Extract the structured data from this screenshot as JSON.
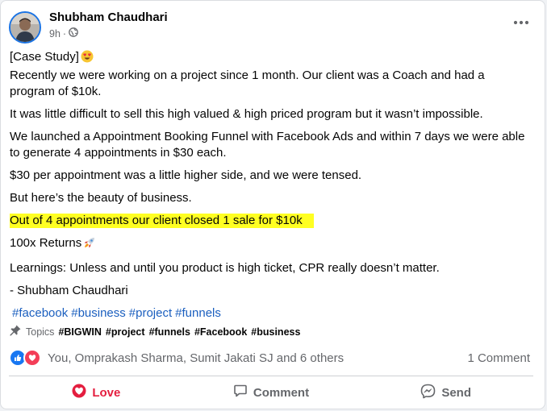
{
  "post": {
    "author": "Shubham Chaudhari",
    "time": "9h",
    "separator": "·",
    "visibility_icon": "globe-icon",
    "more_icon": "more-options-icon"
  },
  "body": {
    "line1": "[Case Study]",
    "line1_emoji": "heart-eyes-emoji",
    "p1": "Recently we were working on a project since 1 month. Our client was a Coach and had a program of $10k.",
    "p2": "It was little difficult to sell this high valued & high priced program but it wasn’t impossible.",
    "p3": "We launched a Appointment Booking Funnel with Facebook Ads and within 7 days we were able to generate 4 appointments in $30 each.",
    "p4": "$30 per appointment was a little higher side, and we were tensed.",
    "p5": "But here’s the beauty of business.",
    "highlight": "Out of 4 appointments our client closed 1 sale for $10k",
    "highlight_color": "#ffff22",
    "p6": "100x Returns",
    "p6_emoji": "rocket-emoji",
    "p7": "Learnings: Unless and until you product is high ticket, CPR really doesn’t matter.",
    "signature": "- Shubham Chaudhari",
    "hashtags": [
      "#facebook",
      "#business",
      "#project",
      "#funnels"
    ]
  },
  "topics": {
    "label": "Topics",
    "tags": [
      "#BIGWIN",
      "#project",
      "#funnels",
      "#Facebook",
      "#business"
    ]
  },
  "reactions": {
    "summary": "You, Omprakash Sharma, Sumit Jakati SJ and 6 others",
    "comment_count": "1 Comment",
    "like_color": "#1877f2",
    "love_color": "#f33e58"
  },
  "actions": {
    "love": "Love",
    "comment": "Comment",
    "send": "Send",
    "love_color": "#e41e3f"
  }
}
